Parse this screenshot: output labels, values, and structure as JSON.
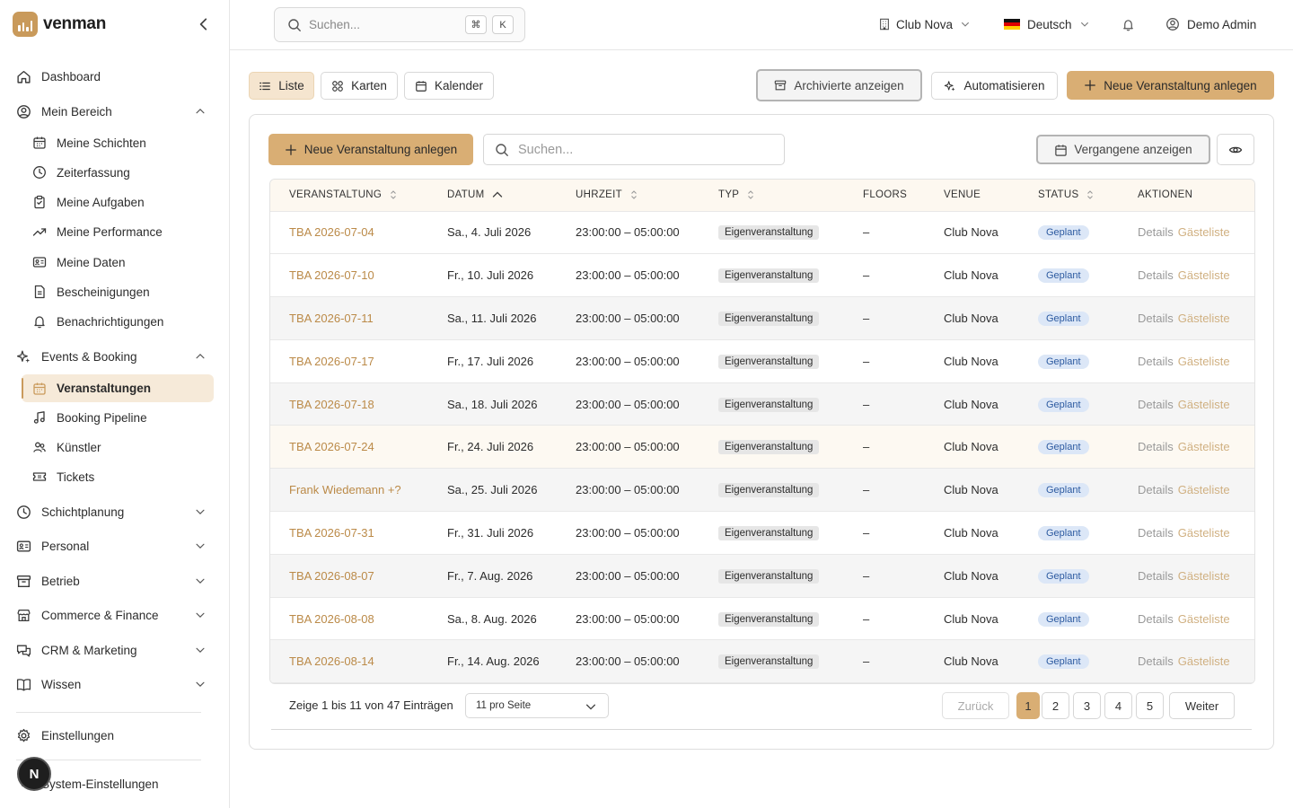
{
  "brand": {
    "name": "venman"
  },
  "sidebar": {
    "dashboard": "Dashboard",
    "mein_bereich": "Mein Bereich",
    "mein_bereich_items": [
      "Meine Schichten",
      "Zeiterfassung",
      "Meine Aufgaben",
      "Meine Performance",
      "Meine Daten",
      "Bescheinigungen",
      "Benachrichtigungen"
    ],
    "events_booking": "Events & Booking",
    "events_items": [
      "Veranstaltungen",
      "Booking Pipeline",
      "Künstler",
      "Tickets"
    ],
    "sections": [
      "Schichtplanung",
      "Personal",
      "Betrieb",
      "Commerce & Finance",
      "CRM & Marketing",
      "Wissen"
    ],
    "einstellungen": "Einstellungen",
    "system_einstellungen": "System-Einstellungen",
    "avatar_letter": "N"
  },
  "topbar": {
    "search_placeholder": "Suchen...",
    "kbd_cmd": "⌘",
    "kbd_k": "K",
    "venue": "Club Nova",
    "language": "Deutsch",
    "user": "Demo Admin"
  },
  "toolbar": {
    "view_list": "Liste",
    "view_cards": "Karten",
    "view_calendar": "Kalender",
    "archived": "Archivierte anzeigen",
    "automate": "Automatisieren",
    "new_event": "Neue Veranstaltung anlegen"
  },
  "card": {
    "new_event": "Neue Veranstaltung anlegen",
    "search_placeholder": "Suchen...",
    "past": "Vergangene anzeigen"
  },
  "table": {
    "headers": [
      "VERANSTALTUNG",
      "DATUM",
      "UHRZEIT",
      "TYP",
      "FLOORS",
      "VENUE",
      "STATUS",
      "AKTIONEN"
    ],
    "action_details": "Details",
    "action_guestlist": "Gästeliste",
    "rows": [
      {
        "name": "TBA 2026-07-04",
        "date": "Sa., 4. Juli 2026",
        "time": "23:00:00 – 05:00:00",
        "type": "Eigenveranstaltung",
        "floors": "–",
        "venue": "Club Nova",
        "status": "Geplant"
      },
      {
        "name": "TBA 2026-07-10",
        "date": "Fr., 10. Juli 2026",
        "time": "23:00:00 – 05:00:00",
        "type": "Eigenveranstaltung",
        "floors": "–",
        "venue": "Club Nova",
        "status": "Geplant"
      },
      {
        "name": "TBA 2026-07-11",
        "date": "Sa., 11. Juli 2026",
        "time": "23:00:00 – 05:00:00",
        "type": "Eigenveranstaltung",
        "floors": "–",
        "venue": "Club Nova",
        "status": "Geplant"
      },
      {
        "name": "TBA 2026-07-17",
        "date": "Fr., 17. Juli 2026",
        "time": "23:00:00 – 05:00:00",
        "type": "Eigenveranstaltung",
        "floors": "–",
        "venue": "Club Nova",
        "status": "Geplant"
      },
      {
        "name": "TBA 2026-07-18",
        "date": "Sa., 18. Juli 2026",
        "time": "23:00:00 – 05:00:00",
        "type": "Eigenveranstaltung",
        "floors": "–",
        "venue": "Club Nova",
        "status": "Geplant"
      },
      {
        "name": "TBA 2026-07-24",
        "date": "Fr., 24. Juli 2026",
        "time": "23:00:00 – 05:00:00",
        "type": "Eigenveranstaltung",
        "floors": "–",
        "venue": "Club Nova",
        "status": "Geplant"
      },
      {
        "name": "Frank Wiedemann +?",
        "date": "Sa., 25. Juli 2026",
        "time": "23:00:00 – 05:00:00",
        "type": "Eigenveranstaltung",
        "floors": "–",
        "venue": "Club Nova",
        "status": "Geplant"
      },
      {
        "name": "TBA 2026-07-31",
        "date": "Fr., 31. Juli 2026",
        "time": "23:00:00 – 05:00:00",
        "type": "Eigenveranstaltung",
        "floors": "–",
        "venue": "Club Nova",
        "status": "Geplant"
      },
      {
        "name": "TBA 2026-08-07",
        "date": "Fr., 7. Aug. 2026",
        "time": "23:00:00 – 05:00:00",
        "type": "Eigenveranstaltung",
        "floors": "–",
        "venue": "Club Nova",
        "status": "Geplant"
      },
      {
        "name": "TBA 2026-08-08",
        "date": "Sa., 8. Aug. 2026",
        "time": "23:00:00 – 05:00:00",
        "type": "Eigenveranstaltung",
        "floors": "–",
        "venue": "Club Nova",
        "status": "Geplant"
      },
      {
        "name": "TBA 2026-08-14",
        "date": "Fr., 14. Aug. 2026",
        "time": "23:00:00 – 05:00:00",
        "type": "Eigenveranstaltung",
        "floors": "–",
        "venue": "Club Nova",
        "status": "Geplant"
      }
    ]
  },
  "pagination": {
    "prefix": "Zeige",
    "from": "1",
    "to_word": "bis",
    "to": "11",
    "of_word": "von",
    "total": "47",
    "suffix": "Einträgen",
    "per_page": "11 pro Seite",
    "prev": "Zurück",
    "next": "Weiter",
    "pages": [
      "1",
      "2",
      "3",
      "4",
      "5"
    ],
    "current": "1"
  },
  "colors": {
    "accent": "#d9ae74",
    "accent_light": "#f5e5cf",
    "link": "#bb8a48",
    "status_bg": "#dce7f7"
  }
}
